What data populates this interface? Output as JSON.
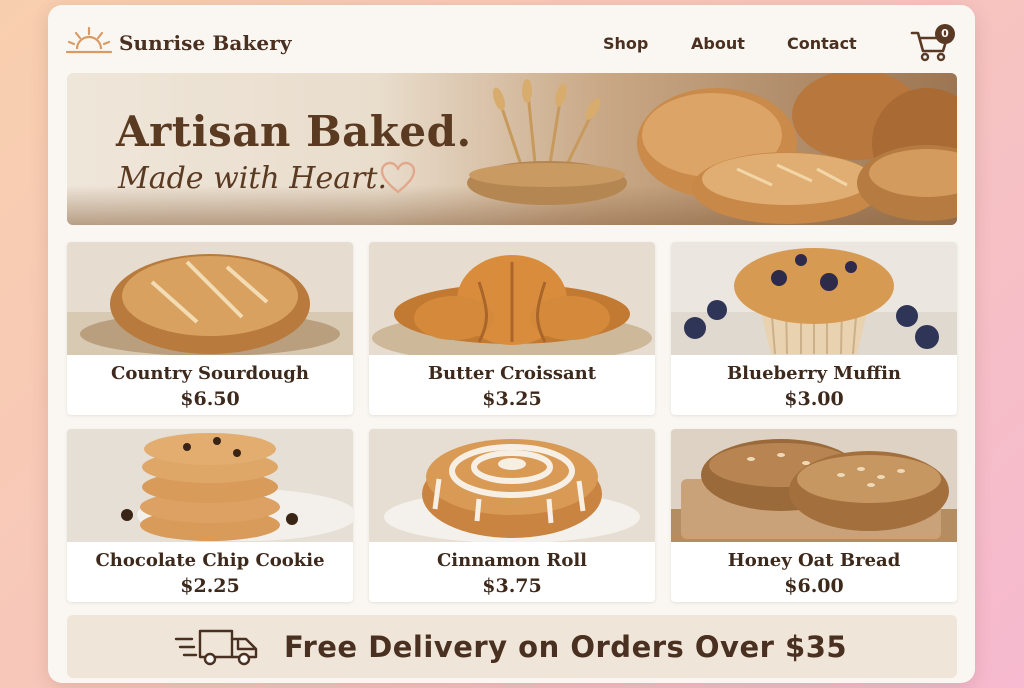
{
  "header": {
    "brand": "Sunrise Bakery",
    "nav": [
      {
        "label": "Shop"
      },
      {
        "label": "About"
      },
      {
        "label": "Contact"
      }
    ],
    "cart_count": "0"
  },
  "hero": {
    "title": "Artisan Baked.",
    "subtitle": "Made with Heart."
  },
  "products": [
    {
      "name": "Country Sourdough",
      "price": "$6.50"
    },
    {
      "name": "Butter Croissant",
      "price": "$3.25"
    },
    {
      "name": "Blueberry Muffin",
      "price": "$3.00"
    },
    {
      "name": "Chocolate Chip Cookie",
      "price": "$2.25"
    },
    {
      "name": "Cinnamon Roll",
      "price": "$3.75"
    },
    {
      "name": "Honey Oat Bread",
      "price": "$6.00"
    }
  ],
  "delivery": {
    "text": "Free Delivery on Orders Over $35"
  },
  "colors": {
    "brand_brown": "#5b3a22",
    "panel": "#faf7f2",
    "banner": "#efe5d8",
    "background_gradient": [
      "#f8cfae",
      "#f6b9cf"
    ]
  },
  "icons": {
    "logo": "sunrise-icon",
    "cart": "shopping-cart-icon",
    "delivery": "delivery-truck-icon",
    "heart": "heart-outline-icon"
  }
}
